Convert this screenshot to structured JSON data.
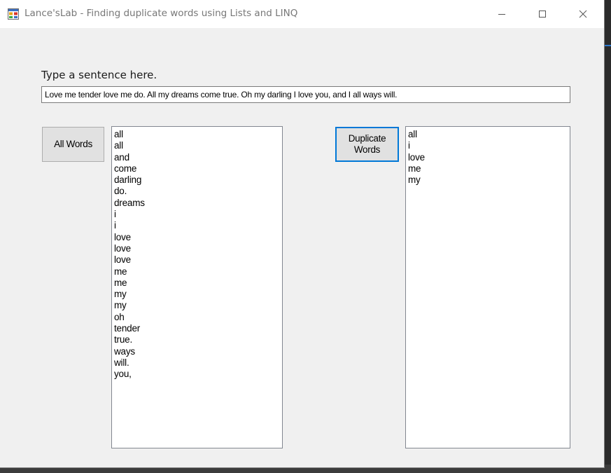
{
  "window": {
    "title": "Lance'sLab - Finding duplicate words using Lists and LINQ",
    "app_icon": "winforms-app-icon",
    "controls": {
      "minimize_icon": "minimize-icon",
      "maximize_icon": "maximize-icon",
      "close_icon": "close-icon"
    }
  },
  "form": {
    "prompt_label": "Type a sentence here.",
    "sentence_value": "Love me tender love me do. All my dreams come true. Oh my darling I love you, and I all ways will.",
    "all_words_button": "All Words",
    "duplicate_words_button": "Duplicate\nWords",
    "all_words_list": [
      "all",
      "all",
      "and",
      "come",
      "darling",
      "do.",
      "dreams",
      "i",
      "i",
      "love",
      "love",
      "love",
      "me",
      "me",
      "my",
      "my",
      "oh",
      "tender",
      "true.",
      "ways",
      "will.",
      "you,"
    ],
    "duplicate_words_list": [
      "all",
      "i",
      "love",
      "me",
      "my"
    ]
  },
  "colors": {
    "focus_border": "#0078d7",
    "form_background": "#f0f0f0",
    "titlebar_background": "#ffffff",
    "title_text": "#777777"
  }
}
